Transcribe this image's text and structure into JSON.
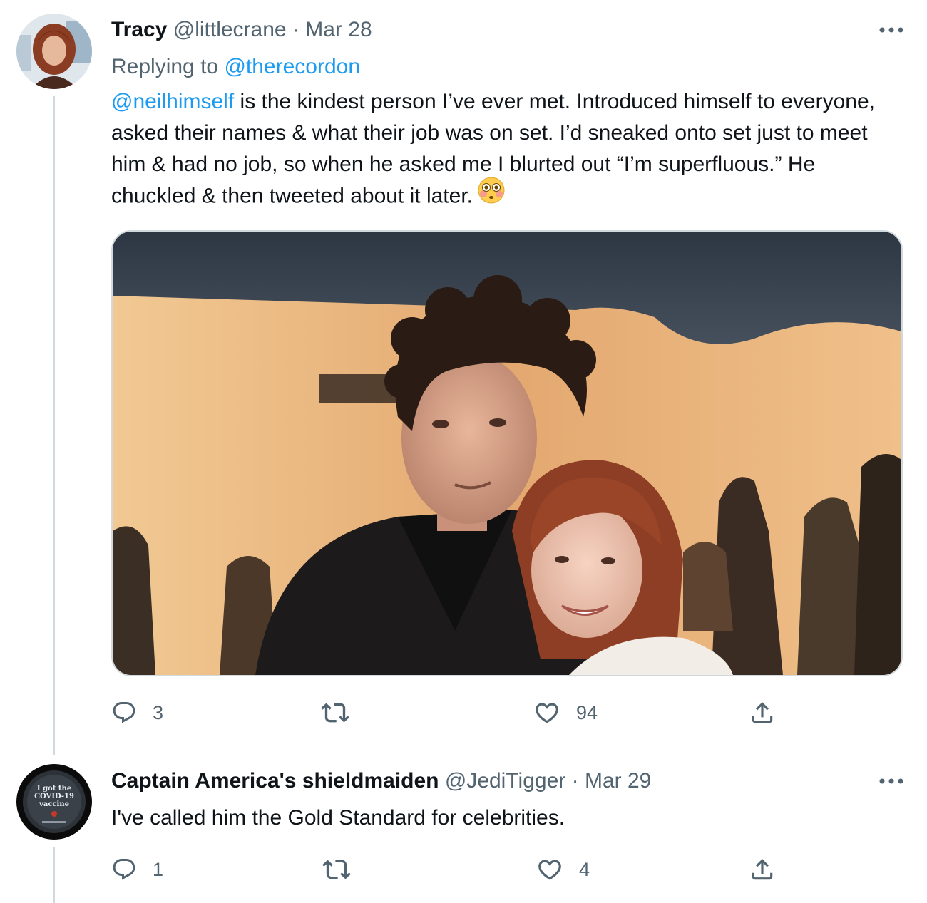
{
  "tweets": [
    {
      "author_name": "Tracy",
      "handle": "@littlecrane",
      "separator": "·",
      "date": "Mar 28",
      "replying_prefix": "Replying to",
      "replying_to": "@therecordon",
      "text_mention": "@neilhimself",
      "text": " is the kindest person I’ve ever met. Introduced himself to everyone, asked their names & what their job was on set. I’d sneaked onto set just to meet him & had no job, so when he asked me I blurted out “I’m superfluous.” He chuckled & then tweeted about it later.",
      "emoji": "flushed-face-emoji",
      "replies": "3",
      "retweets": "",
      "likes": "94",
      "icons": [
        "more-icon",
        "reply-icon",
        "retweet-icon",
        "like-icon",
        "share-icon"
      ]
    },
    {
      "author_name": "Captain America's shieldmaiden",
      "handle": "@JediTigger",
      "separator": "·",
      "date": "Mar 29",
      "text": "I've called him the Gold Standard for celebrities.",
      "avatar_badge_line1": "I got the",
      "avatar_badge_line2": "COVID-19",
      "avatar_badge_line3": "vaccine",
      "replies": "1",
      "retweets": "",
      "likes": "4"
    }
  ],
  "colors": {
    "text": "#0f1419",
    "secondary": "#536471",
    "link": "#1d9bf0",
    "border": "#cfd9de"
  }
}
